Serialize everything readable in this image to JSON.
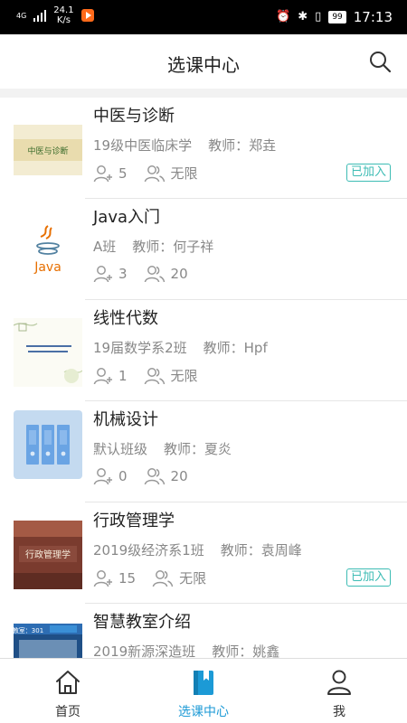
{
  "status_bar": {
    "network": "4G",
    "speed_value": "24.1",
    "speed_unit": "K/s",
    "battery": "99",
    "time": "17:13"
  },
  "header": {
    "title": "选课中心"
  },
  "courses": [
    {
      "title": "中医与诊断",
      "class_name": "19级中医临床学",
      "teacher": "教师：郑垚",
      "members": "5",
      "capacity": "无限",
      "joined_label": "已加入",
      "thumb_text": "中医与诊断"
    },
    {
      "title": "Java入门",
      "class_name": "A班",
      "teacher": "教师：何子祥",
      "members": "3",
      "capacity": "20",
      "thumb_text": "Java"
    },
    {
      "title": "线性代数",
      "class_name": "19届数学系2班",
      "teacher": "教师：Hpf",
      "members": "1",
      "capacity": "无限"
    },
    {
      "title": "机械设计",
      "class_name": "默认班级",
      "teacher": "教师：夏炎",
      "members": "0",
      "capacity": "20"
    },
    {
      "title": "行政管理学",
      "class_name": "2019级经济系1班",
      "teacher": "教师：袁周峰",
      "members": "15",
      "capacity": "无限",
      "joined_label": "已加入",
      "thumb_text": "行政管理学"
    },
    {
      "title": "智慧教室介绍",
      "class_name": "2019新源深造班",
      "teacher": "教师：姚鑫",
      "thumb_text": "教室：301"
    }
  ],
  "tabbar": {
    "home": "首页",
    "courses": "选课中心",
    "me": "我"
  },
  "colors": {
    "accent": "#1c9ad6",
    "joined": "#3dbcb4",
    "muted_text": "#888888"
  },
  "icons": [
    "search-icon",
    "add-person-icon",
    "group-icon",
    "home-icon",
    "book-icon",
    "user-icon"
  ]
}
